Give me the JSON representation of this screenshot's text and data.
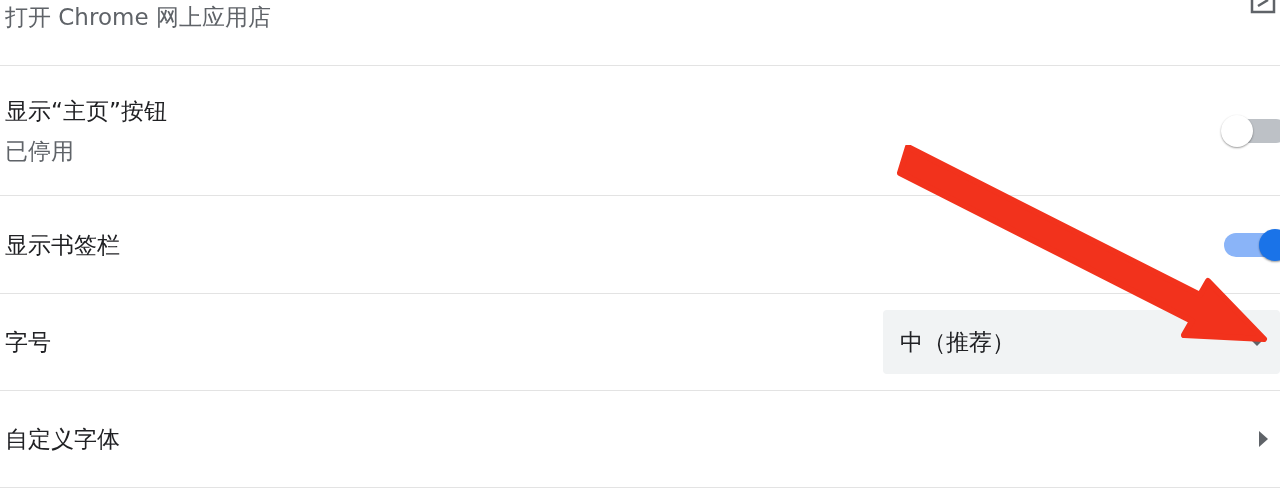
{
  "rows": [
    {
      "kind": "link",
      "label": "打开 Chrome 网上应用店"
    },
    {
      "kind": "toggle",
      "label": "显示“主页”按钮",
      "sublabel": "已停用",
      "on": false
    },
    {
      "kind": "toggle",
      "label": "显示书签栏",
      "on": true
    },
    {
      "kind": "select",
      "label": "字号",
      "value": "中（推荐）"
    },
    {
      "kind": "submenu",
      "label": "自定义字体"
    }
  ]
}
